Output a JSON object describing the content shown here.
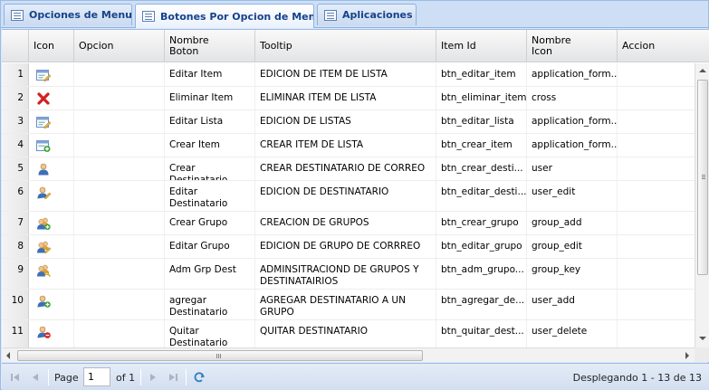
{
  "tabs": [
    {
      "label": "Opciones de Menu",
      "active": false
    },
    {
      "label": "Botones Por Opcion de Menu",
      "active": true
    },
    {
      "label": "Aplicaciones",
      "active": false
    }
  ],
  "columns": {
    "icon": "Icon",
    "opcion": "Opcion",
    "nombre_boton": "Nombre Boton",
    "tooltip": "Tooltip",
    "item_id": "Item Id",
    "nombre_icon": "Nombre Icon",
    "accion": "Accion"
  },
  "rows": [
    {
      "num": "1",
      "icon": "application-form-edit-icon",
      "opcion": "",
      "nombre_boton": "Editar Item",
      "tooltip": "EDICION DE ITEM DE LISTA",
      "item_id": "btn_editar_item",
      "nombre_icon": "application_form...",
      "accion": ""
    },
    {
      "num": "2",
      "icon": "cross-icon",
      "opcion": "",
      "nombre_boton": "Eliminar Item",
      "tooltip": "ELIMINAR ITEM DE LISTA",
      "item_id": "btn_eliminar_item",
      "nombre_icon": "cross",
      "accion": ""
    },
    {
      "num": "3",
      "icon": "application-form-edit-icon",
      "opcion": "",
      "nombre_boton": "Editar Lista",
      "tooltip": "EDICION DE LISTAS",
      "item_id": "btn_editar_lista",
      "nombre_icon": "application_form...",
      "accion": ""
    },
    {
      "num": "4",
      "icon": "application-form-add-icon",
      "opcion": "",
      "nombre_boton": "Crear Item",
      "tooltip": "CREAR ITEM DE LISTA",
      "item_id": "btn_crear_item",
      "nombre_icon": "application_form...",
      "accion": ""
    },
    {
      "num": "5",
      "icon": "user-icon",
      "opcion": "",
      "nombre_boton": "Crear Destinatario",
      "tooltip": "CREAR DESTINATARIO DE CORREO",
      "item_id": "btn_crear_desti...",
      "nombre_icon": "user",
      "accion": ""
    },
    {
      "num": "6",
      "icon": "user-edit-icon",
      "opcion": "",
      "nombre_boton": "Editar Destinatario",
      "tooltip": "EDICION DE DESTINATARIO",
      "item_id": "btn_editar_desti...",
      "nombre_icon": "user_edit",
      "accion": ""
    },
    {
      "num": "7",
      "icon": "group-add-icon",
      "opcion": "",
      "nombre_boton": "Crear Grupo",
      "tooltip": "CREACION DE GRUPOS",
      "item_id": "btn_crear_grupo",
      "nombre_icon": "group_add",
      "accion": ""
    },
    {
      "num": "8",
      "icon": "group-edit-icon",
      "opcion": "",
      "nombre_boton": "Editar Grupo",
      "tooltip": "EDICION DE GRUPO DE CORRREO",
      "item_id": "btn_editar_grupo",
      "nombre_icon": "group_edit",
      "accion": ""
    },
    {
      "num": "9",
      "icon": "group-key-icon",
      "opcion": "",
      "nombre_boton": "Adm Grp Dest",
      "tooltip": "ADMINSITRACIOND DE GRUPOS Y DESTINATAIRIOS",
      "item_id": "btn_adm_grupo...",
      "nombre_icon": "group_key",
      "accion": ""
    },
    {
      "num": "10",
      "icon": "user-add-icon",
      "opcion": "",
      "nombre_boton": "agregar Destinatario",
      "tooltip": "AGREGAR DESTINATARIO A UN GRUPO",
      "item_id": "btn_agregar_de...",
      "nombre_icon": "user_add",
      "accion": ""
    },
    {
      "num": "11",
      "icon": "user-delete-icon",
      "opcion": "",
      "nombre_boton": "Quitar Destinatario",
      "tooltip": "QUITAR DESTINATARIO",
      "item_id": "btn_quitar_dest...",
      "nombre_icon": "user_delete",
      "accion": ""
    }
  ],
  "pager": {
    "page_label": "Page",
    "page_value": "1",
    "of_label": "of 1",
    "status": "Desplegando 1 - 13 de 13",
    "first_icon": "first-page-icon",
    "prev_icon": "prev-page-icon",
    "next_icon": "next-page-icon",
    "last_icon": "last-page-icon",
    "refresh_icon": "refresh-icon"
  },
  "colors": {
    "accent": "#15428b",
    "panel_bg": "#dfe8f6",
    "border": "#99bbe8"
  }
}
